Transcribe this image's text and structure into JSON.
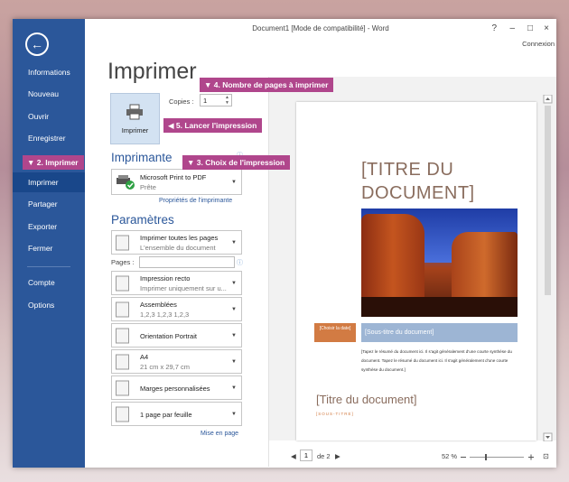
{
  "window": {
    "title": "Document1 [Mode de compatibilité] - Word",
    "help": "?",
    "minimize": "–",
    "maximize": "□",
    "close": "×",
    "account": "Connexion"
  },
  "sidebar": {
    "back_icon": "←",
    "items": [
      {
        "label": "Informations"
      },
      {
        "label": "Nouveau"
      },
      {
        "label": "Ouvrir"
      },
      {
        "label": "Enregistrer"
      },
      {
        "label": "Imprimer"
      },
      {
        "label": "Partager"
      },
      {
        "label": "Exporter"
      },
      {
        "label": "Fermer"
      },
      {
        "label": "Compte"
      },
      {
        "label": "Options"
      }
    ],
    "active": "Imprimer",
    "color": "#2b579a"
  },
  "main": {
    "heading": "Imprimer",
    "copies_label": "Copies :",
    "copies_value": "1",
    "print_button": "Imprimer",
    "printer_section": "Imprimante",
    "printer_name": "Microsoft Print to PDF",
    "printer_status": "Prête",
    "printer_props": "Propriétés de l'imprimante",
    "settings_section": "Paramètres",
    "settings": [
      {
        "line1": "Imprimer toutes les pages",
        "line2": "L'ensemble du document"
      },
      {
        "line1": "Impression recto",
        "line2": "Imprimer uniquement sur u..."
      },
      {
        "line1": "Assemblées",
        "line2": "1,2,3    1,2,3    1,2,3"
      },
      {
        "line1": "Orientation Portrait",
        "line2": ""
      },
      {
        "line1": "A4",
        "line2": "21 cm x 29,7 cm"
      },
      {
        "line1": "Marges personnalisées",
        "line2": ""
      },
      {
        "line1": "1 page par feuille",
        "line2": ""
      }
    ],
    "pages_label": "Pages :",
    "page_setup_link": "Mise en page"
  },
  "preview": {
    "doc_title": "[TITRE DU DOCUMENT]",
    "date": "[Choisir la date]",
    "subtitle": "[Sous-titre du document]",
    "summary": "[Tapez le résumé du document ici. Il s'agit généralement d'une courte synthèse du document. Tapez le résumé du document ici. Il s'agit généralement d'une courte synthèse du document.]",
    "title2": "[Titre du document]",
    "sous_titre": "[SOUS-TITRE]",
    "page_current": "1",
    "page_total": "de 2",
    "zoom": "52 %",
    "accent": "#d27b43"
  },
  "callouts": {
    "c2": "▼ 2. Imprimer",
    "c3": "▼ 3. Choix de l'impression",
    "c4": "▼ 4. Nombre de pages à imprimer",
    "c5": "◀ 5. Lancer l'impression",
    "color": "#b0468c"
  }
}
